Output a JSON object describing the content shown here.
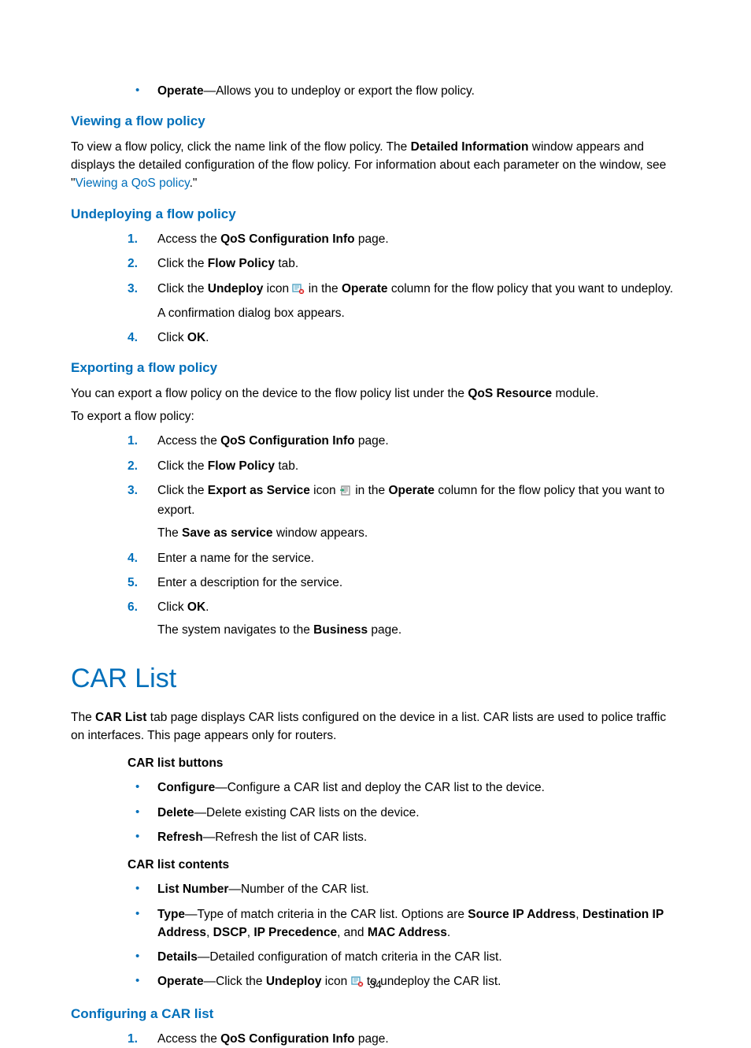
{
  "page_number": "34",
  "intro_bullet": {
    "term": "Operate",
    "desc": "—Allows you to undeploy or export the flow policy."
  },
  "viewing": {
    "heading": "Viewing a flow policy",
    "para_parts": {
      "p1a": "To view a flow policy, click the name link of the flow policy. The ",
      "p1b": "Detailed Information",
      "p1c": " window appears and displays the detailed configuration of the flow policy. For information about each parameter on the window, see \"",
      "link": "Viewing a QoS policy",
      "p1d": ".\""
    }
  },
  "undeploying": {
    "heading": "Undeploying a flow policy",
    "steps": [
      {
        "n": "1.",
        "pre": "Access the ",
        "bold": "QoS Configuration Info",
        "post": " page."
      },
      {
        "n": "2.",
        "pre": "Click the ",
        "bold": "Flow Policy",
        "post": " tab."
      },
      {
        "n": "3.",
        "pre": "Click the ",
        "bold": "Undeploy",
        "mid1": " icon ",
        "icon": "undeploy",
        "mid2": " in the ",
        "bold2": "Operate",
        "post": " column for the flow policy that you want to undeploy.",
        "sub": "A confirmation dialog box appears."
      },
      {
        "n": "4.",
        "pre": "Click ",
        "bold": "OK",
        "post": "."
      }
    ]
  },
  "exporting": {
    "heading": "Exporting a flow policy",
    "intro1a": "You can export a flow policy on the device to the flow policy list under the ",
    "intro1b": "QoS Resource",
    "intro1c": " module.",
    "intro2": "To export a flow policy:",
    "steps": [
      {
        "n": "1.",
        "pre": "Access the ",
        "bold": "QoS Configuration Info",
        "post": " page."
      },
      {
        "n": "2.",
        "pre": "Click the ",
        "bold": "Flow Policy",
        "post": " tab."
      },
      {
        "n": "3.",
        "pre": "Click the ",
        "bold": "Export as Service",
        "mid1": " icon ",
        "icon": "export",
        "mid2": " in the ",
        "bold2": "Operate",
        "post": " column for the flow policy that you want to export.",
        "sub_pre": "The ",
        "sub_bold": "Save as service",
        "sub_post": " window appears."
      },
      {
        "n": "4.",
        "text": "Enter a name for the service."
      },
      {
        "n": "5.",
        "text": "Enter a description for the service."
      },
      {
        "n": "6.",
        "pre": "Click ",
        "bold": "OK",
        "post": ".",
        "sub_pre": "The system navigates to the ",
        "sub_bold": "Business",
        "sub_post": " page."
      }
    ]
  },
  "carlist": {
    "heading": "CAR List",
    "intro_pre": "The ",
    "intro_bold": "CAR List",
    "intro_post": " tab page displays CAR lists configured on the device in a list. CAR lists are used to police traffic on interfaces. This page appears only for routers.",
    "buttons_label": "CAR list buttons",
    "buttons": [
      {
        "term": "Configure",
        "desc": "—Configure a CAR list and deploy the CAR list to the device."
      },
      {
        "term": "Delete",
        "desc": "—Delete existing CAR lists on the device."
      },
      {
        "term": "Refresh",
        "desc": "—Refresh the list of CAR lists."
      }
    ],
    "contents_label": "CAR list contents",
    "contents": [
      {
        "term": "List Number",
        "desc": "—Number of the CAR list."
      },
      {
        "term": "Type",
        "desc_pre": "—Type of match criteria in the CAR list. Options are ",
        "b1": "Source IP Address",
        "s1": ", ",
        "b2": "Destination IP Address",
        "s2": ", ",
        "b3": "DSCP",
        "s3": ", ",
        "b4": "IP Precedence",
        "s4": ", and ",
        "b5": "MAC Address",
        "s5": "."
      },
      {
        "term": "Details",
        "desc": "—Detailed configuration of match criteria in the CAR list."
      },
      {
        "term": "Operate",
        "desc_pre": "—Click the ",
        "b1": "Undeploy",
        "desc_mid": " icon ",
        "icon": "undeploy",
        "desc_post": " to undeploy the CAR list."
      }
    ]
  },
  "configuring": {
    "heading": "Configuring a CAR list",
    "step1": {
      "n": "1.",
      "pre": "Access the ",
      "bold": "QoS Configuration Info",
      "post": " page."
    }
  }
}
